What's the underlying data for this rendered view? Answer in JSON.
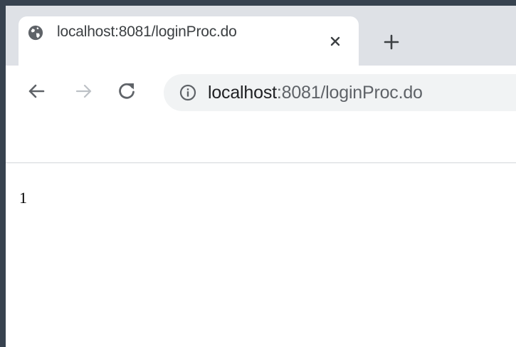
{
  "tab": {
    "title": "localhost:8081/loginProc.do"
  },
  "omnibox": {
    "host": "localhost",
    "rest": ":8081/loginProc.do"
  },
  "page": {
    "body_text": "1"
  },
  "icons": {
    "favicon": "globe-icon",
    "tab_close": "close-icon",
    "new_tab": "plus-icon",
    "back": "arrow-left-icon",
    "forward": "arrow-right-icon",
    "reload": "reload-icon",
    "site_info": "info-icon"
  },
  "colors": {
    "frame": "#37424f",
    "tabstrip": "#dee1e6",
    "omnibox": "#f1f3f4",
    "text_dark": "#202124",
    "text_muted": "#5f6368",
    "disabled": "#bdc1c6"
  }
}
